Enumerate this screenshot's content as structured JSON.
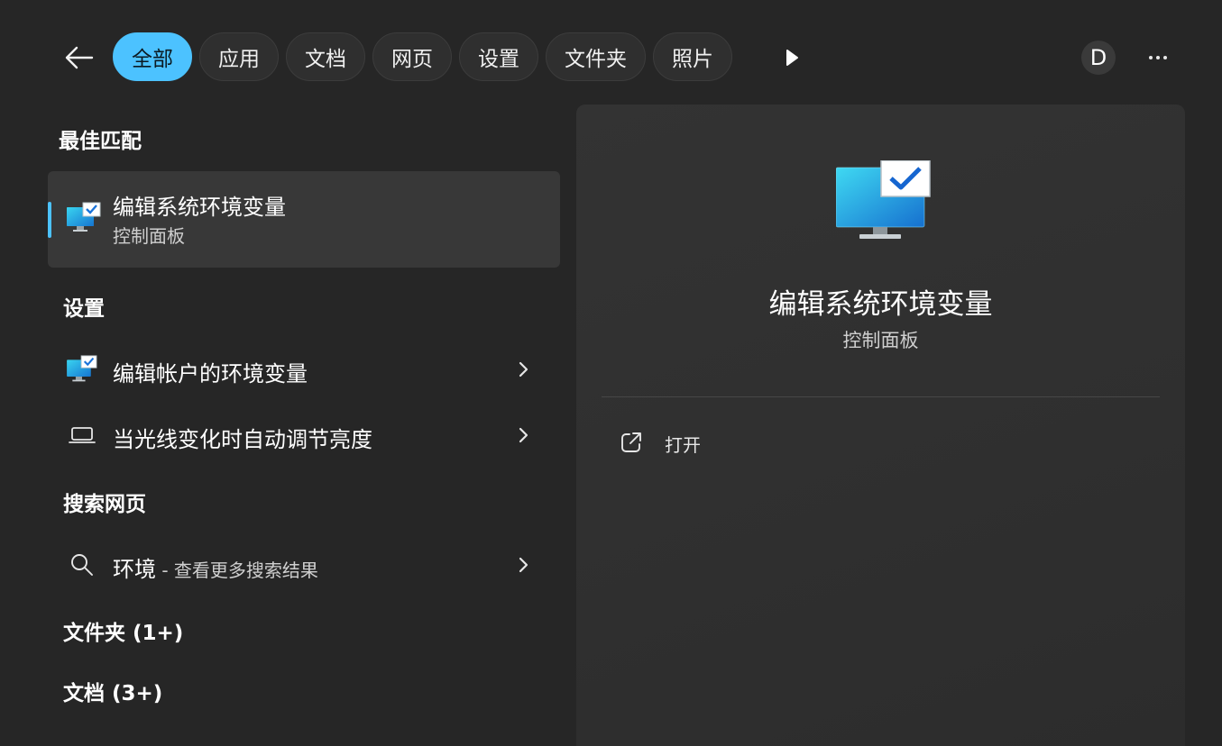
{
  "tabs": [
    {
      "label": "全部",
      "active": true
    },
    {
      "label": "应用",
      "active": false
    },
    {
      "label": "文档",
      "active": false
    },
    {
      "label": "网页",
      "active": false
    },
    {
      "label": "设置",
      "active": false
    },
    {
      "label": "文件夹",
      "active": false
    },
    {
      "label": "照片",
      "active": false
    }
  ],
  "header": {
    "avatar_initial": "D",
    "icons": {
      "back": "back-arrow-icon",
      "more_tabs": "play-icon",
      "overflow": "more-icon"
    }
  },
  "best_match": {
    "section_title": "最佳匹配",
    "title": "编辑系统环境变量",
    "subtitle": "控制面板",
    "icon": "control-panel-monitor-icon"
  },
  "settings": {
    "section_title": "设置",
    "items": [
      {
        "label": "编辑帐户的环境变量",
        "icon": "control-panel-monitor-icon"
      },
      {
        "label": "当光线变化时自动调节亮度",
        "icon": "laptop-icon"
      }
    ]
  },
  "web_search": {
    "section_title": "搜索网页",
    "query": "环境",
    "suffix": " - 查看更多搜索结果",
    "icon": "search-icon"
  },
  "folders": {
    "section_title": "文件夹 (1+)"
  },
  "documents": {
    "section_title": "文档 (3+)"
  },
  "detail": {
    "title": "编辑系统环境变量",
    "subtitle": "控制面板",
    "actions": [
      {
        "label": "打开",
        "icon": "open-external-icon"
      }
    ]
  },
  "colors": {
    "accent": "#4cc2ff",
    "background": "#262626",
    "card": "#383838",
    "panel": "#323232"
  }
}
